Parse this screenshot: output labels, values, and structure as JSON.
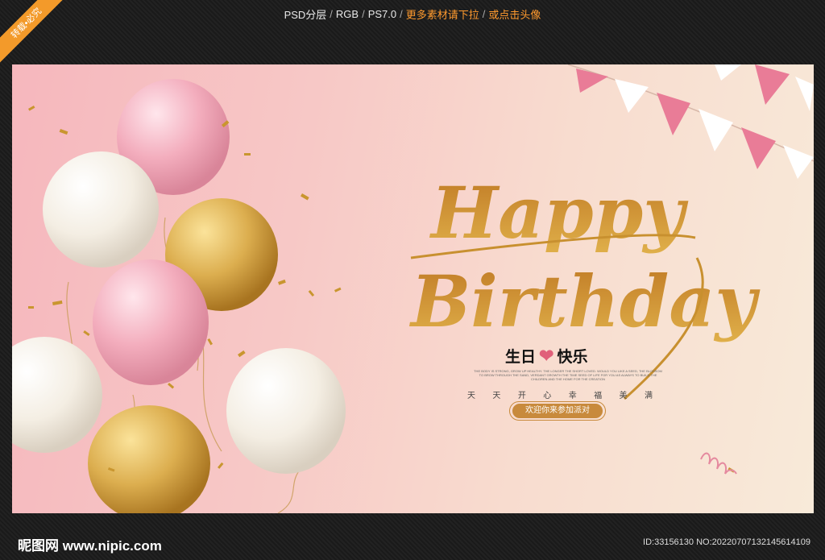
{
  "header": {
    "segments": [
      "PSD分层",
      "RGB",
      "PS7.0",
      "更多素材请下拉",
      "或点击头像"
    ],
    "separator": "/"
  },
  "corner_badge": "转载•必究",
  "poster": {
    "script_line1": "Happy",
    "script_line2": "Birthday",
    "title_left": "生日",
    "title_right": "快乐",
    "heart_icon": "heart-icon",
    "fine_print": "THE BODY IS STRONG, GROW UP HEALTHY. THE LONGER THE SHORT LOVED. WOULD YOU LIKE A SEED, THE BLOSSOM TO BROW THROUGH THE SAND, VERDANT GROWTH THE TIME SEED OF LIFE FOR YOU AS ALWAYS TO BUILD THE CHILDREN AND THE HOME FOR THE CREATION",
    "daily_chars": [
      "天",
      "天",
      "开",
      "心",
      "幸",
      "福",
      "美",
      "满"
    ],
    "invite_label": "欢迎你来参加派对",
    "colors": {
      "gold": "#c8902f",
      "pink": "#e58a9f",
      "pink_flag": "#e97c97",
      "white_flag": "#ffffff"
    }
  },
  "footer": {
    "logo": "昵图网 www.nipic.com",
    "id_text": "ID:33156130 NO:20220707132145614109"
  }
}
